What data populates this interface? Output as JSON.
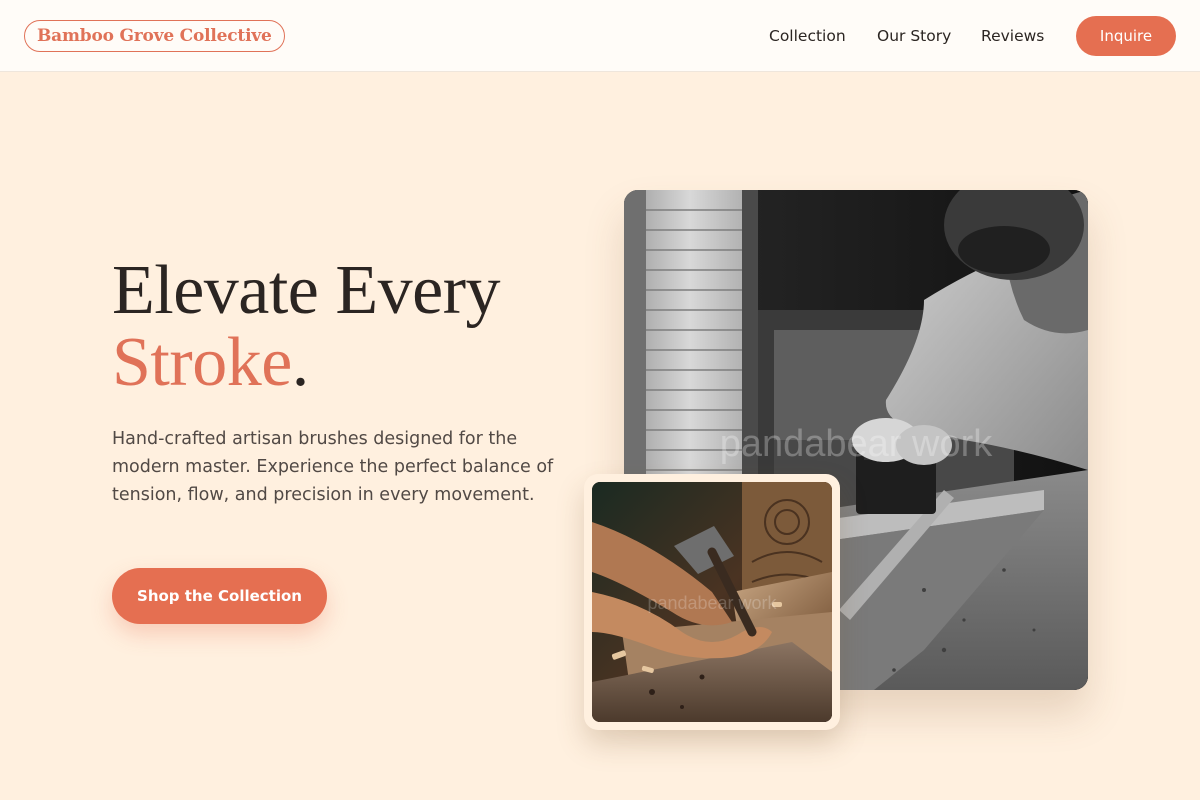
{
  "header": {
    "brand": "Bamboo Grove Collective",
    "nav": {
      "collection": "Collection",
      "story": "Our Story",
      "reviews": "Reviews"
    },
    "cta": "Inquire"
  },
  "hero": {
    "title_line1": "Elevate Every",
    "title_accent": "Stroke",
    "title_period": ".",
    "description": "Hand-crafted artisan brushes designed for the modern master. Experience the perfect balance of tension, flow, and precision in every movement.",
    "cta": "Shop the Collection"
  },
  "images": {
    "main_watermark": "pandabear work",
    "thumb_watermark": "pandabear work"
  },
  "colors": {
    "accent": "#e56f51",
    "background": "#fff0df",
    "header_bg": "#fffcf8",
    "text": "#2b2522"
  }
}
